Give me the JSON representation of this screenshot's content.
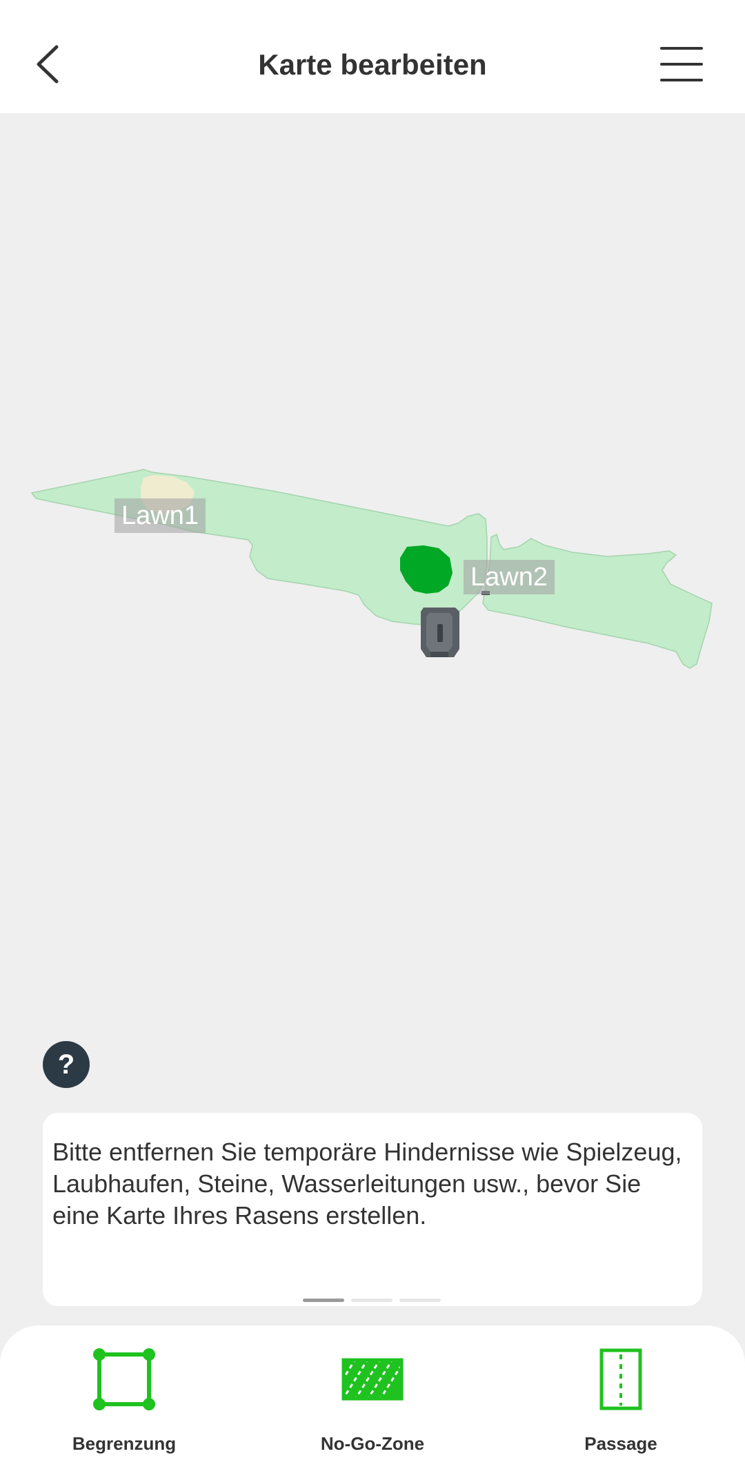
{
  "header": {
    "title": "Karte bearbeiten",
    "back_icon": "chevron-left-icon",
    "menu_icon": "hamburger-menu-icon"
  },
  "map": {
    "lawns": [
      {
        "name": "Lawn1"
      },
      {
        "name": "Lawn2"
      }
    ],
    "colors": {
      "background": "#efefef",
      "lawn_fill": "#c3ecca",
      "obstacle_fill": "#00a825",
      "highlight_fill": "#f0ecd0",
      "station": "#5a5f66"
    }
  },
  "help": {
    "icon": "question-mark-icon",
    "symbol": "?"
  },
  "tip": {
    "text": "Bitte entfernen Sie temporäre Hindernisse wie Spielzeug, Laubhaufen, Steine, Wasserleitungen usw., bevor Sie eine Karte Ihres Rasens erstellen.",
    "page_count": 3,
    "active_page": 1
  },
  "toolbar": {
    "accent_color": "#1fc21f",
    "items": [
      {
        "label": "Begrenzung",
        "icon": "boundary-square-icon"
      },
      {
        "label": "No-Go-Zone",
        "icon": "no-go-zone-hatched-icon"
      },
      {
        "label": "Passage",
        "icon": "passage-dashed-icon"
      }
    ]
  }
}
